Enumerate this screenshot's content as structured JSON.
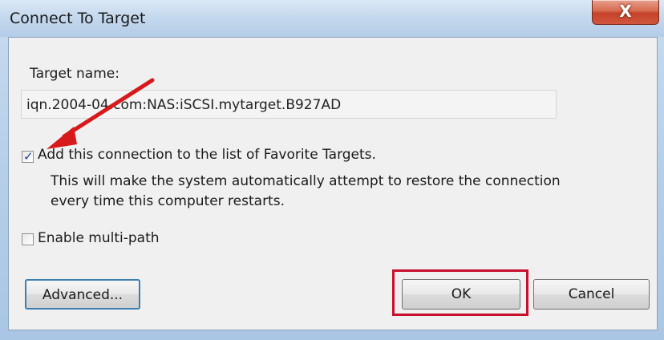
{
  "window": {
    "title": "Connect To Target",
    "close_glyph": "X"
  },
  "dialog": {
    "target_label": "Target name:",
    "target_value": "iqn.2004-04.com:NAS:iSCSI.mytarget.B927AD",
    "favorite_checkbox": {
      "label": "Add this connection to the list of Favorite Targets.",
      "checked": true
    },
    "favorite_description": "This will make the system automatically attempt to restore the connection every time this computer restarts.",
    "multipath_checkbox": {
      "label": "Enable multi-path",
      "checked": false
    },
    "buttons": {
      "advanced": "Advanced...",
      "ok": "OK",
      "cancel": "Cancel"
    }
  },
  "annotations": {
    "arrow_color": "#d7191c",
    "highlight_color": "#c8102e"
  }
}
